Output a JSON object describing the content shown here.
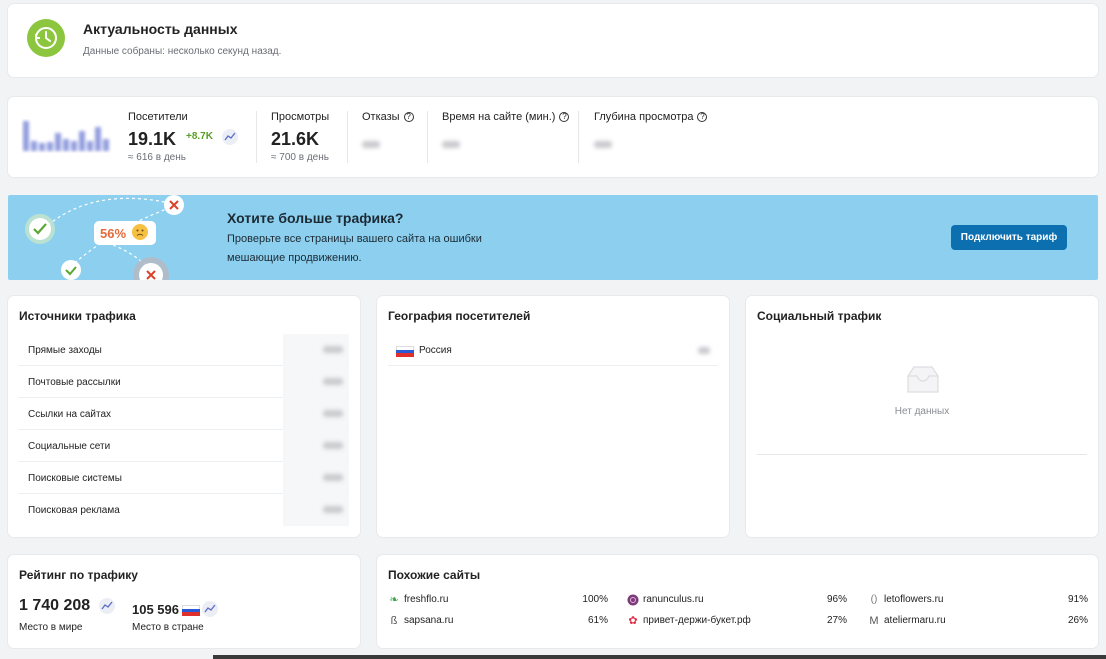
{
  "freshness": {
    "title": "Актуальность данных",
    "subtitle": "Данные собраны: несколько секунд назад.",
    "icon": "clock-refresh-icon"
  },
  "metrics": {
    "visitors": {
      "label": "Посетители",
      "value": "19.1K",
      "delta": "+8.7K",
      "per_day": "≈ 616 в день"
    },
    "views": {
      "label": "Просмотры",
      "value": "21.6K",
      "per_day": "≈ 700 в день"
    },
    "bounces": {
      "label": "Отказы"
    },
    "time_on_site": {
      "label": "Время на сайте (мин.)"
    },
    "depth": {
      "label": "Глубина просмотра"
    }
  },
  "banner": {
    "title": "Хотите больше трафика?",
    "text": "Проверьте все страницы вашего сайта на ошибки мешающие продвижению.",
    "button": "Подключить тариф",
    "badge": "56%",
    "colors": {
      "background": "#8ccfef",
      "button": "#0b6fb0"
    }
  },
  "traffic_sources": {
    "title": "Источники трафика",
    "rows": [
      "Прямые заходы",
      "Почтовые рассылки",
      "Ссылки на сайтах",
      "Социальные сети",
      "Поисковые системы",
      "Поисковая реклама"
    ]
  },
  "geography": {
    "title": "География посетителей",
    "rows": [
      {
        "country": "Россия",
        "flag": "ru-flag-icon"
      }
    ]
  },
  "social": {
    "title": "Социальный трафик",
    "empty_text": "Нет данных",
    "icon": "empty-inbox-icon"
  },
  "rating": {
    "title": "Рейтинг по трафику",
    "world_value": "1 740 208",
    "world_label": "Место в мире",
    "country_value": "105 596",
    "country_label": "Место в стране"
  },
  "similar": {
    "title": "Похожие сайты",
    "items": [
      {
        "domain": "freshflo.ru",
        "percent": "100%",
        "icon": "leaf-icon"
      },
      {
        "domain": "ranunculus.ru",
        "percent": "96%",
        "icon": "flower-circle-icon"
      },
      {
        "domain": "letoflowers.ru",
        "percent": "91%",
        "icon": "bracket-logo-icon"
      },
      {
        "domain": "sapsana.ru",
        "percent": "61%",
        "icon": "s-logo-icon"
      },
      {
        "domain": "привет-держи-букет.рф",
        "percent": "27%",
        "icon": "red-flower-icon"
      },
      {
        "domain": "ateliermaru.ru",
        "percent": "26%",
        "icon": "m-logo-icon"
      }
    ]
  }
}
